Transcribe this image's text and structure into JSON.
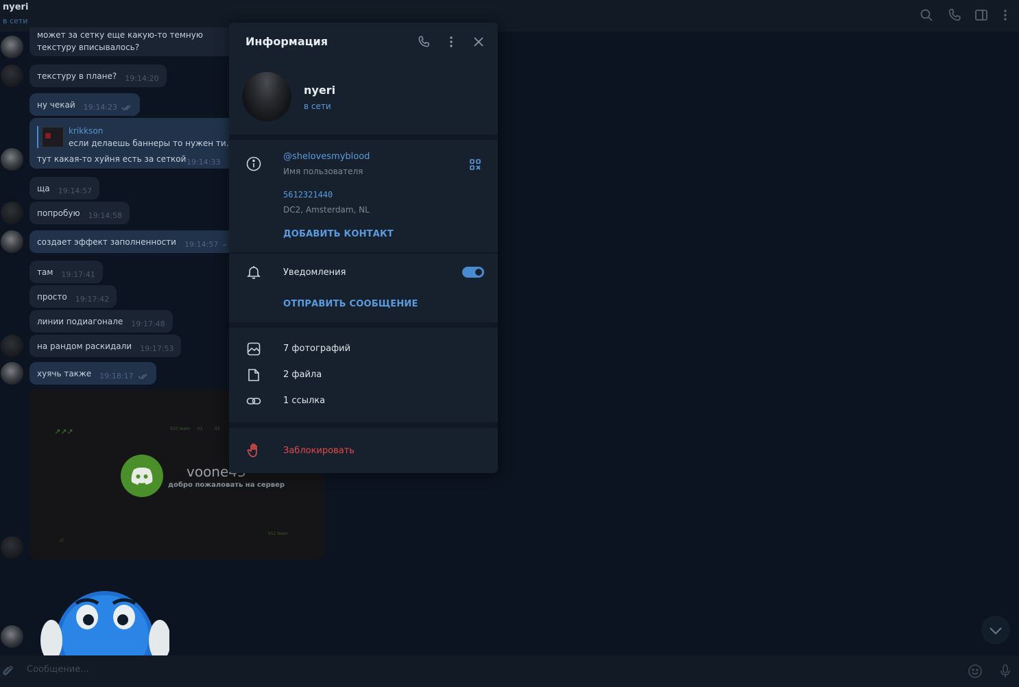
{
  "header": {
    "name": "nyeri",
    "status": "в сети",
    "icons": [
      "search-icon",
      "phone-icon",
      "sidebar-icon",
      "more-vertical-icon"
    ]
  },
  "messages": [
    {
      "text": "может за сетку еще какую-то темную текстуру вписывалось?"
    },
    {
      "text": "текстуру в плане?",
      "time": "19:14:20",
      "out": false
    },
    {
      "text": "ну чекай",
      "time": "19:14:23",
      "out": true
    },
    {
      "reply_name": "krikkson",
      "reply_text": "если делаешь баннеры то нужен ти...",
      "text": "тут какая-то хуйня есть за сеткой",
      "time": "19:14:33",
      "out": true
    },
    {
      "text": "ща",
      "time": "19:14:57",
      "out": false
    },
    {
      "text": "попробую",
      "time": "19:14:58",
      "out": false
    },
    {
      "text": "создает эффект заполненности",
      "time": "19:14:57",
      "out": true
    },
    {
      "text": "там",
      "time": "19:17:41",
      "out": false
    },
    {
      "text": "просто",
      "time": "19:17:42",
      "out": false
    },
    {
      "text": "линии подиагонале",
      "time": "19:17:48",
      "out": false
    },
    {
      "text": "на рандом раскидали",
      "time": "19:17:53",
      "out": false
    },
    {
      "text": "хуячь также",
      "time": "19:18:17",
      "out": true
    }
  ],
  "banner": {
    "title": "voone43",
    "subtitle": "добро пожаловать на сервер",
    "tiny_top": "910 team",
    "tiny_a": "01",
    "tiny_b": "02",
    "tiny_bottom": "911 team",
    "tiny_corner": "///"
  },
  "composer": {
    "placeholder": "Сообщение..."
  },
  "info_panel": {
    "title": "Информация",
    "name": "nyeri",
    "status": "в сети",
    "username": "@shelovesmyblood",
    "username_label": "Имя пользователя",
    "user_id": "5612321440",
    "dc": "DC2, Amsterdam, NL",
    "add_contact": "ДОБАВИТЬ КОНТАКТ",
    "notifications": "Уведомления",
    "notifications_on": true,
    "send_message": "ОТПРАВИТЬ СООБЩЕНИЕ",
    "photos": "7 фотографий",
    "files": "2 файла",
    "links": "1 ссылка",
    "block": "Заблокировать"
  },
  "colors": {
    "accent": "#5a9be0",
    "danger": "#e04a4a",
    "panel": "#17212e",
    "background": "#0b1420"
  }
}
